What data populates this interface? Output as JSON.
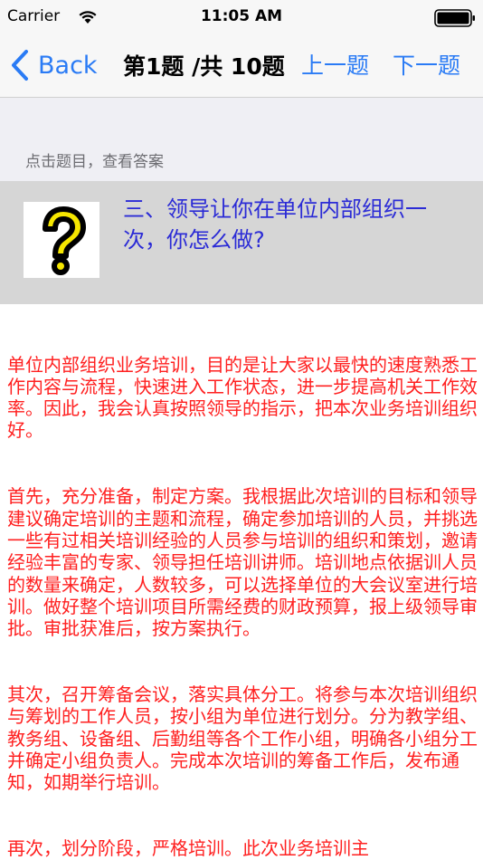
{
  "status_bar": {
    "carrier": "Carrier",
    "time": "11:05 AM"
  },
  "nav": {
    "back_label": "Back",
    "title": "第1题 /共 10题",
    "prev_label": "上一题",
    "next_label": "下一题"
  },
  "hint": "点击题目，查看答案",
  "question": {
    "icon": "question-mark-icon",
    "text": "三、领导让你在单位内部组织一次，你怎么做?"
  },
  "answer": {
    "paragraphs": [
      "单位内部组织业务培训，目的是让大家以最快的速度熟悉工作内容与流程，快速进入工作状态，进一步提高机关工作效率。因此，我会认真按照领导的指示，把本次业务培训组织好。",
      "首先，充分准备，制定方案。我根据此次培训的目标和领导建议确定培训的主题和流程，确定参加培训的人员，并挑选一些有过相关培训经验的人员参与培训的组织和策划，邀请经验丰富的专家、领导担任培训讲师。培训地点依据训人员的数量来确定，人数较多，可以选择单位的大会议室进行培训。做好整个培训项目所需经费的财政预算，报上级领导审批。审批获准后，按方案执行。",
      "其次，召开筹备会议，落实具体分工。将参与本次培训组织与筹划的工作人员，按小组为单位进行划分。分为教学组、教务组、设备组、后勤组等各个工作小组，明确各小组分工并确定小组负责人。完成本次培训的筹备工作后，发布通知，如期举行培训。",
      "再次，划分阶段，严格培训。此次业务培训主"
    ]
  },
  "colors": {
    "accent": "#2a7bf5",
    "question_text": "#2b2bd6",
    "answer_text": "#ff2020",
    "question_bg": "#d6d6d6"
  }
}
